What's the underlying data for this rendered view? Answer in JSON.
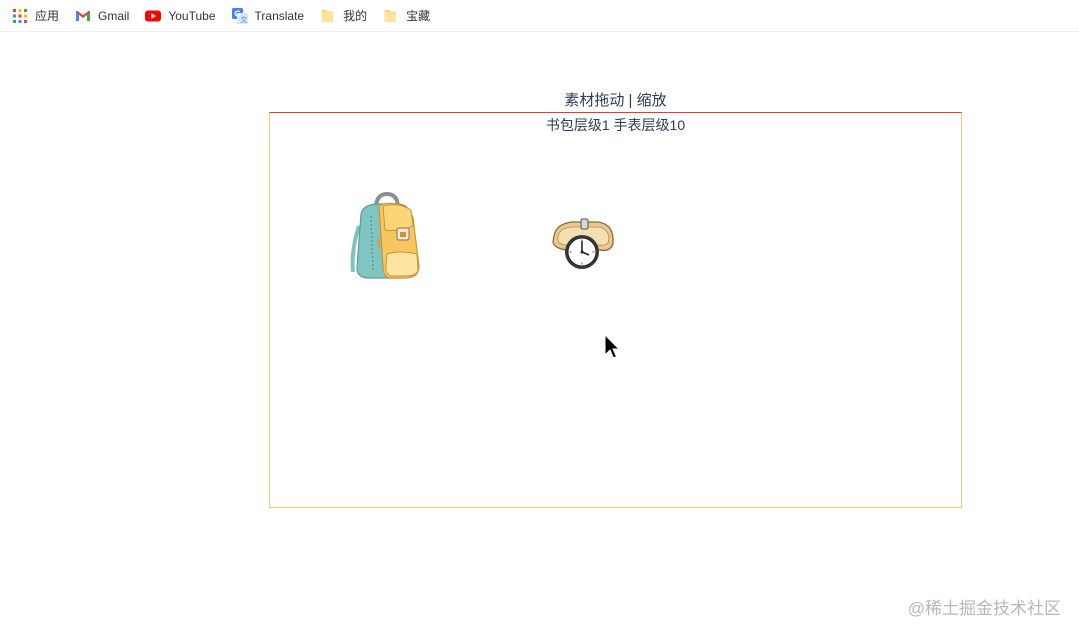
{
  "bookmarks": [
    {
      "label": "应用",
      "icon": "apps-grid-icon"
    },
    {
      "label": "Gmail",
      "icon": "gmail-icon"
    },
    {
      "label": "YouTube",
      "icon": "youtube-icon"
    },
    {
      "label": "Translate",
      "icon": "translate-icon"
    },
    {
      "label": "我的",
      "icon": "folder-icon"
    },
    {
      "label": "宝藏",
      "icon": "folder-icon"
    }
  ],
  "main": {
    "title": "素材拖动 | 缩放",
    "subtitle": "书包层级1 手表层级10"
  },
  "canvas": {
    "items": [
      {
        "name": "backpack",
        "icon": "backpack-icon"
      },
      {
        "name": "watch",
        "icon": "watch-icon"
      }
    ]
  },
  "watermark": "@稀土掘金技术社区",
  "colors": {
    "canvas_border": "#f5c66e",
    "canvas_top_border": "#e23b3b",
    "title_text": "#2c3e50"
  }
}
